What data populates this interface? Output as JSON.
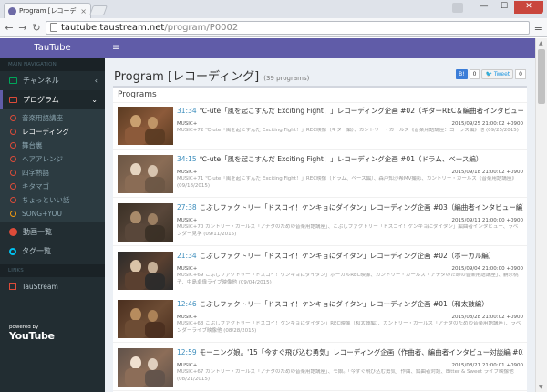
{
  "browser": {
    "tab_title": "Program [レコーディング] - ",
    "url_host": "tautube.taustream.net",
    "url_path": "/program/P0002"
  },
  "sidebar": {
    "logo": "TauTube",
    "main_header": "MAIN NAVIGATION",
    "items": [
      {
        "label": "チャンネル",
        "icon": "tv-icon"
      },
      {
        "label": "プログラム",
        "icon": "youtube-icon"
      },
      {
        "label": "動画一覧",
        "icon": "video-list-icon"
      },
      {
        "label": "タグ一覧",
        "icon": "tag-icon"
      }
    ],
    "sub_items": [
      "音楽用語講座",
      "レコーディング",
      "舞台裏",
      "ヘアアレンジ",
      "四字熟語",
      "キタマゴ",
      "ちょっといい話",
      "SONG+YOU"
    ],
    "links_header": "LINKS",
    "links": [
      "TauStream"
    ],
    "powered_by": "powered by",
    "youtube": "YouTube"
  },
  "page": {
    "title": "Program [レコーディング]",
    "count": "(39 programs)",
    "box_title": "Programs",
    "share": {
      "fb_count": "0",
      "tweet_label": "Tweet",
      "tweet_count": "0"
    }
  },
  "programs": [
    {
      "duration": "31:34",
      "title": "℃-ute「風を起こすんだ Exciting Fight！」レコーディング企画 #02（ギターREC＆編曲者インタビュー編）",
      "channel": "MUSIC+",
      "date": "2015/09/25 21:00:02 +0900",
      "desc": "MUSIC+72 ℃-ute「風を起こすんだ Exciting Fight！」REC映像（ギター編）、カントリー・ガールズ《音楽用語講座：コーラス編》他 (09/25/2015)"
    },
    {
      "duration": "34:15",
      "title": "℃-ute「風を起こすんだ Exciting Fight！」レコーディング企画 #01（ドラム、ベース編）",
      "channel": "MUSIC+",
      "date": "2015/09/18 21:00:02 +0900",
      "desc": "MUSIC+71 ℃-ute「風を起こすんだ Exciting Fight！」REC映像（ドラム、ベース編）、森戸知沙希MV撮影、カントリー・ガールズ《音楽用語講座》 (09/18/2015)"
    },
    {
      "duration": "27:38",
      "title": "こぶしファクトリー「ドスコイ！ケンキョにダイタン」レコーディング企画 #03（編曲者インタビュー編）",
      "channel": "MUSIC+",
      "date": "2015/09/11 21:00:00 +0900",
      "desc": "MUSIC+70 カントリー・ガールズ「アナタのための音楽用語講座」、こぶしファクトリー「ドスコイ！ケンキョにダイタン」編曲者インタビュー、ラベンダー見学 (09/11/2015)"
    },
    {
      "duration": "21:34",
      "title": "こぶしファクトリー「ドスコイ！ケンキョにダイタン」レコーディング企画 #02（ボーカル編）",
      "channel": "MUSIC+",
      "date": "2015/09/04 21:00:00 +0900",
      "desc": "MUSIC+69 こぶしファクトリー「ドスコイ！ケンキョにダイタン」ボーカルREC映像、カントリー・ガールズ「アナタのための音楽用語講座」、嗣永桃子、中島卓偉ライブ映像他 (09/04/2015)"
    },
    {
      "duration": "12:46",
      "title": "こぶしファクトリー「ドスコイ！ケンキョにダイタン」レコーディング企画 #01（和太鼓編）",
      "channel": "MUSIC+",
      "date": "2015/08/28 21:00:02 +0900",
      "desc": "MUSIC+68 こぶしファクトリー「ドスコイ！ケンキョにダイタン」REC映像（和太鼓編）、カントリー・ガールズ「アナタのための音楽用語講座」、ラベンダーライブ映像他 (08/28/2015)"
    },
    {
      "duration": "12:59",
      "title": "モーニング娘。'15「今すぐ飛び込む勇気」レコーディング企画（作曲者、編曲者インタビュー対談編 #03）",
      "channel": "MUSIC+",
      "date": "2015/08/21 21:00:01 +0900",
      "desc": "MUSIC+67 カントリー・ガールズ「アナタのための音楽用語講座」、モ娘。「今すぐ飛び込む勇気」作曲、編曲者対談、Bitter & Sweet ライブ映像他 (08/21/2015)"
    }
  ]
}
